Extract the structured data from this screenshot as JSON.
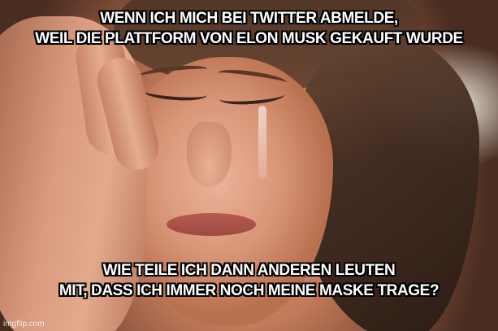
{
  "meme": {
    "top_text": {
      "line1": "WENN ICH MICH BEI TWITTER ABMELDE,",
      "line2": "WEIL DIE PLATTFORM VON ELON MUSK GEKAUFT WURDE"
    },
    "bottom_text": {
      "line1": "WIE TEILE ICH DANN ANDEREN LEUTEN",
      "line2": "MIT, DASS ICH IMMER NOCH MEINE MASKE TRAGE?"
    },
    "watermark": "imgflip.com"
  }
}
